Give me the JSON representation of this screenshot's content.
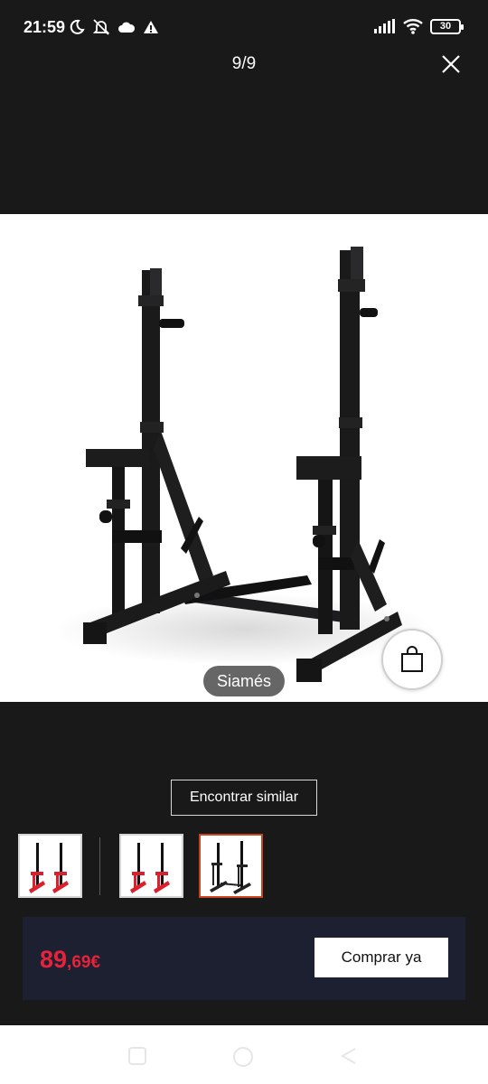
{
  "status_bar": {
    "time": "21:59",
    "left_icons": [
      "moon-icon",
      "bell-off-icon",
      "cloud-icon",
      "warning-icon"
    ],
    "right_icons": [
      "signal-icon",
      "wifi-icon",
      "battery-icon"
    ],
    "battery_level": "30"
  },
  "viewer": {
    "counter": "9/9",
    "close_icon": "close-icon"
  },
  "product": {
    "variant_label": "Siamés",
    "cart_icon": "shopping-bag-icon"
  },
  "actions": {
    "find_similar_label": "Encontrar similar"
  },
  "thumbnails": [
    {
      "name": "red-squat-rack",
      "accent": "#d9202c",
      "selected": false
    },
    {
      "name": "red-squat-rack",
      "accent": "#d9202c",
      "selected": false
    },
    {
      "name": "black-squat-rack",
      "accent": "#222222",
      "selected": true
    }
  ],
  "purchase": {
    "price_integer": "89",
    "price_decimal": ",69€",
    "buy_label": "Comprar ya"
  },
  "colors": {
    "background": "#191919",
    "price": "#e6233a",
    "panel": "#1c2030",
    "selected_border": "#c8451f"
  },
  "nav_bar": {
    "buttons": [
      "recent-apps-icon",
      "home-icon",
      "back-icon"
    ]
  }
}
